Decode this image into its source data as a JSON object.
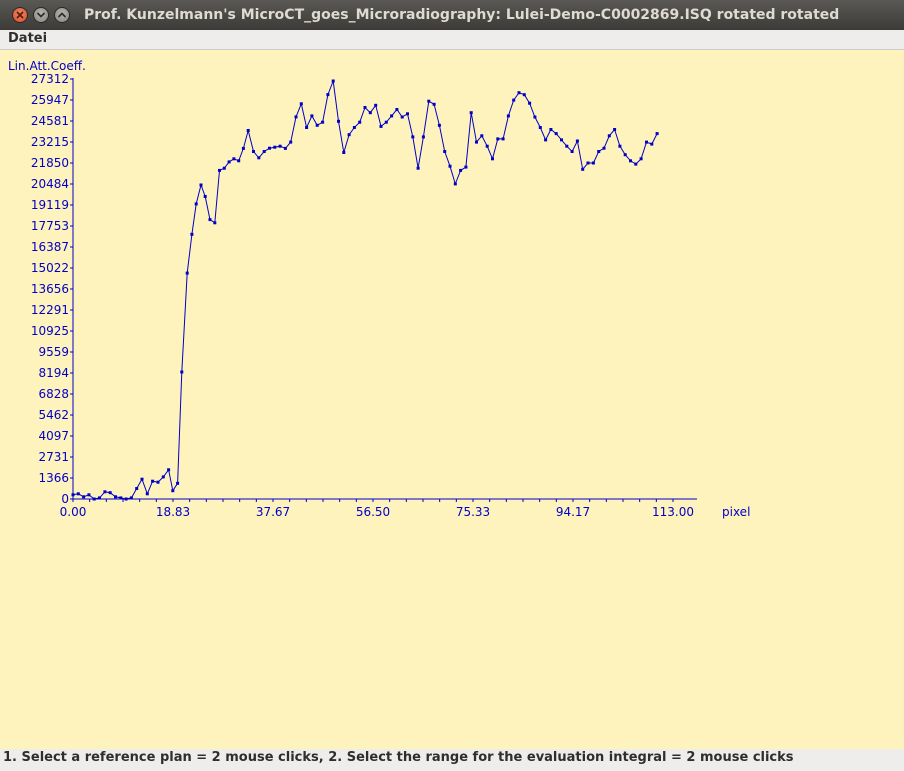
{
  "window": {
    "title": "Prof. Kunzelmann's MicroCT_goes_Microradiography:  Lulei-Demo-C0002869.ISQ rotated rotated"
  },
  "menu": {
    "items": [
      "Datei"
    ]
  },
  "status": {
    "text": "1. Select a reference plan = 2 mouse clicks, 2. Select the range for the evaluation integral = 2 mouse clicks"
  },
  "colors": {
    "plot_bg": "#fff3bd",
    "series": "#0000c8"
  },
  "chart_data": {
    "type": "line",
    "ylabel": "Lin.Att.Coeff.",
    "xlabel": "pixel",
    "ylim": [
      0,
      27312
    ],
    "xlim": [
      0,
      113
    ],
    "y_ticks": [
      "0",
      "1366",
      "2731",
      "4097",
      "5462",
      "6828",
      "8194",
      "9559",
      "10925",
      "12291",
      "13656",
      "15022",
      "16387",
      "17753",
      "19119",
      "20484",
      "21850",
      "23215",
      "24581",
      "25947",
      "27312"
    ],
    "x_ticks": [
      "0.00",
      "18.83",
      "37.67",
      "56.50",
      "75.33",
      "94.17",
      "113.00"
    ],
    "grid": false,
    "series": [
      {
        "values": [
          {
            "x": 0.0,
            "y": 270
          },
          {
            "x": 1.0,
            "y": 340
          },
          {
            "x": 2.0,
            "y": 140
          },
          {
            "x": 3.0,
            "y": 270
          },
          {
            "x": 4.0,
            "y": 0
          },
          {
            "x": 5.0,
            "y": 70
          },
          {
            "x": 6.0,
            "y": 470
          },
          {
            "x": 7.0,
            "y": 410
          },
          {
            "x": 8.0,
            "y": 140
          },
          {
            "x": 9.0,
            "y": 70
          },
          {
            "x": 10.0,
            "y": 0
          },
          {
            "x": 11.0,
            "y": 70
          },
          {
            "x": 12.0,
            "y": 680
          },
          {
            "x": 13.0,
            "y": 1290
          },
          {
            "x": 14.0,
            "y": 340
          },
          {
            "x": 15.0,
            "y": 1160
          },
          {
            "x": 16.0,
            "y": 1090
          },
          {
            "x": 17.0,
            "y": 1440
          },
          {
            "x": 18.0,
            "y": 1900
          },
          {
            "x": 18.8,
            "y": 540
          },
          {
            "x": 19.7,
            "y": 1020
          },
          {
            "x": 20.5,
            "y": 8260
          },
          {
            "x": 21.5,
            "y": 14690
          },
          {
            "x": 22.4,
            "y": 17210
          },
          {
            "x": 23.2,
            "y": 19190
          },
          {
            "x": 24.1,
            "y": 20420
          },
          {
            "x": 24.9,
            "y": 19670
          },
          {
            "x": 25.8,
            "y": 18170
          },
          {
            "x": 26.7,
            "y": 17960
          },
          {
            "x": 27.6,
            "y": 21370
          },
          {
            "x": 28.5,
            "y": 21510
          },
          {
            "x": 29.4,
            "y": 21920
          },
          {
            "x": 30.3,
            "y": 22120
          },
          {
            "x": 31.2,
            "y": 21990
          },
          {
            "x": 32.1,
            "y": 22800
          },
          {
            "x": 33.0,
            "y": 23960
          },
          {
            "x": 34.0,
            "y": 22600
          },
          {
            "x": 35.0,
            "y": 22190
          },
          {
            "x": 36.0,
            "y": 22600
          },
          {
            "x": 37.0,
            "y": 22810
          },
          {
            "x": 38.0,
            "y": 22880
          },
          {
            "x": 39.0,
            "y": 22940
          },
          {
            "x": 40.0,
            "y": 22800
          },
          {
            "x": 41.0,
            "y": 23210
          },
          {
            "x": 42.0,
            "y": 24850
          },
          {
            "x": 43.0,
            "y": 25700
          },
          {
            "x": 44.0,
            "y": 24160
          },
          {
            "x": 45.0,
            "y": 24910
          },
          {
            "x": 46.0,
            "y": 24300
          },
          {
            "x": 47.0,
            "y": 24500
          },
          {
            "x": 48.0,
            "y": 26300
          },
          {
            "x": 49.0,
            "y": 27180
          },
          {
            "x": 50.0,
            "y": 24560
          },
          {
            "x": 51.0,
            "y": 22530
          },
          {
            "x": 52.0,
            "y": 23690
          },
          {
            "x": 53.0,
            "y": 24160
          },
          {
            "x": 54.0,
            "y": 24500
          },
          {
            "x": 55.0,
            "y": 25460
          },
          {
            "x": 56.0,
            "y": 25120
          },
          {
            "x": 57.0,
            "y": 25600
          },
          {
            "x": 58.0,
            "y": 24230
          },
          {
            "x": 59.0,
            "y": 24500
          },
          {
            "x": 60.0,
            "y": 24910
          },
          {
            "x": 61.0,
            "y": 25330
          },
          {
            "x": 62.0,
            "y": 24840
          },
          {
            "x": 63.0,
            "y": 25050
          },
          {
            "x": 64.0,
            "y": 23550
          },
          {
            "x": 65.0,
            "y": 21510
          },
          {
            "x": 66.0,
            "y": 23550
          },
          {
            "x": 67.0,
            "y": 25870
          },
          {
            "x": 68.0,
            "y": 25670
          },
          {
            "x": 69.0,
            "y": 24300
          },
          {
            "x": 70.0,
            "y": 22600
          },
          {
            "x": 71.0,
            "y": 21640
          },
          {
            "x": 72.0,
            "y": 20490
          },
          {
            "x": 73.0,
            "y": 21370
          },
          {
            "x": 74.0,
            "y": 21580
          },
          {
            "x": 75.0,
            "y": 25120
          },
          {
            "x": 76.0,
            "y": 23210
          },
          {
            "x": 77.0,
            "y": 23620
          },
          {
            "x": 78.0,
            "y": 22940
          },
          {
            "x": 79.0,
            "y": 22120
          },
          {
            "x": 80.0,
            "y": 23420
          },
          {
            "x": 81.0,
            "y": 23420
          },
          {
            "x": 82.0,
            "y": 24910
          },
          {
            "x": 83.0,
            "y": 25940
          },
          {
            "x": 84.0,
            "y": 26420
          },
          {
            "x": 85.0,
            "y": 26290
          },
          {
            "x": 86.0,
            "y": 25740
          },
          {
            "x": 87.0,
            "y": 24840
          },
          {
            "x": 88.0,
            "y": 24160
          },
          {
            "x": 89.0,
            "y": 23350
          },
          {
            "x": 90.0,
            "y": 24030
          },
          {
            "x": 91.0,
            "y": 23760
          },
          {
            "x": 92.0,
            "y": 23350
          },
          {
            "x": 93.0,
            "y": 22940
          },
          {
            "x": 94.0,
            "y": 22600
          },
          {
            "x": 95.0,
            "y": 23280
          },
          {
            "x": 96.0,
            "y": 21440
          },
          {
            "x": 97.0,
            "y": 21850
          },
          {
            "x": 98.0,
            "y": 21850
          },
          {
            "x": 99.0,
            "y": 22600
          },
          {
            "x": 100.0,
            "y": 22810
          },
          {
            "x": 101.0,
            "y": 23620
          },
          {
            "x": 102.0,
            "y": 24030
          },
          {
            "x": 103.0,
            "y": 22940
          },
          {
            "x": 104.0,
            "y": 22390
          },
          {
            "x": 105.0,
            "y": 21990
          },
          {
            "x": 106.0,
            "y": 21780
          },
          {
            "x": 107.0,
            "y": 22120
          },
          {
            "x": 108.0,
            "y": 23210
          },
          {
            "x": 109.0,
            "y": 23080
          },
          {
            "x": 110.0,
            "y": 23760
          }
        ]
      }
    ]
  }
}
